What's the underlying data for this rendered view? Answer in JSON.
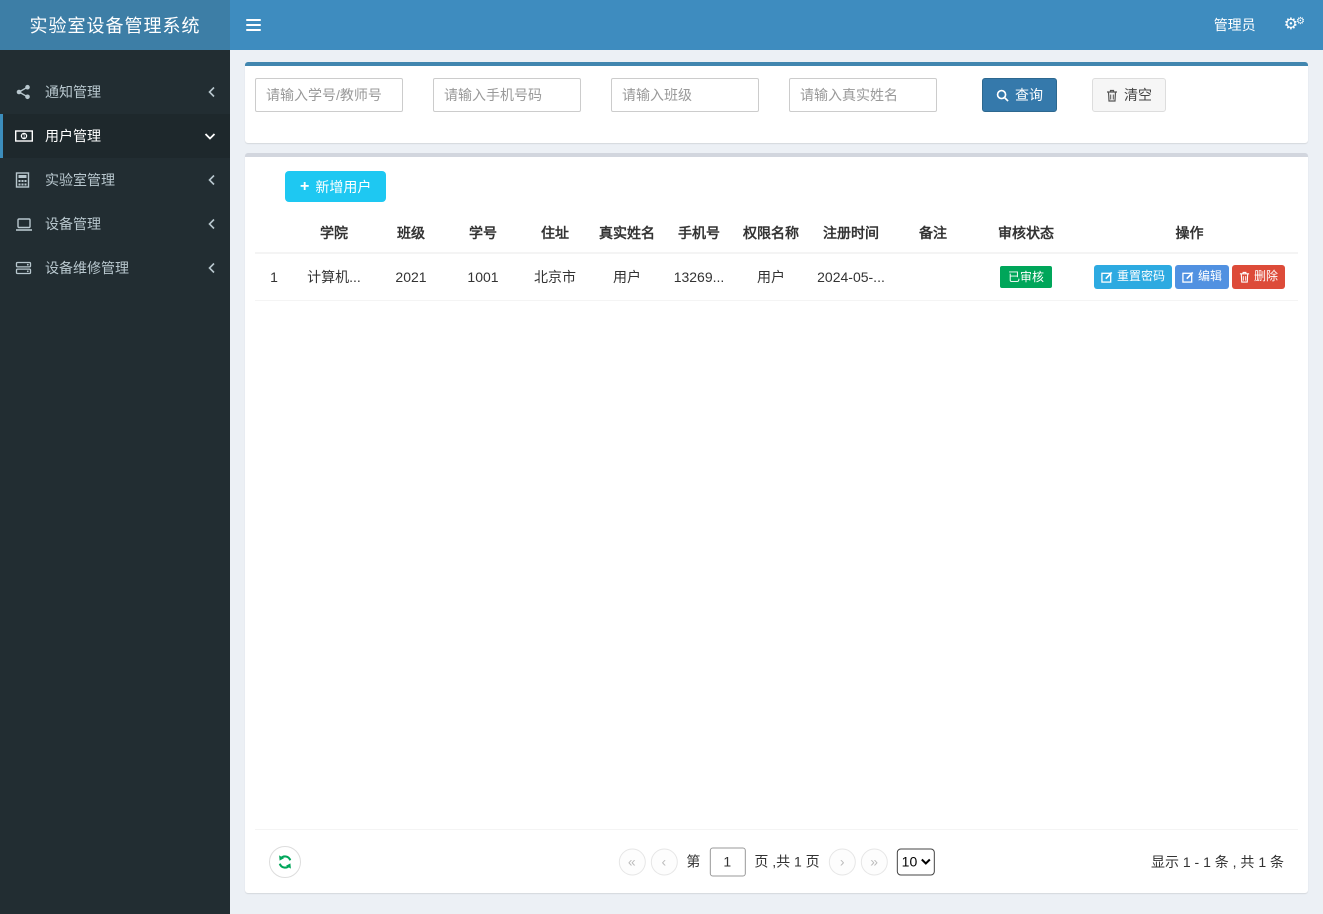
{
  "header": {
    "brand": "实验室设备管理系统",
    "user": "管理员"
  },
  "sidebar": {
    "items": [
      {
        "label": "通知管理"
      },
      {
        "label": "用户管理"
      },
      {
        "label": "实验室管理"
      },
      {
        "label": "设备管理"
      },
      {
        "label": "设备维修管理"
      }
    ]
  },
  "search": {
    "fields": [
      "请输入学号/教师号",
      "请输入手机号码",
      "请输入班级",
      "请输入真实姓名"
    ],
    "query_label": "查询",
    "clear_label": "清空"
  },
  "toolbar": {
    "add_user_label": "新增用户"
  },
  "table": {
    "headers": [
      "",
      "学院",
      "班级",
      "学号",
      "住址",
      "真实姓名",
      "手机号",
      "权限名称",
      "注册时间",
      "备注",
      "审核状态",
      "操作"
    ],
    "rows": [
      {
        "index": "1",
        "college": "计算机...",
        "class_name": "2021",
        "student_no": "1001",
        "address": "北京市",
        "real_name": "用户",
        "phone": "13269...",
        "role": "用户",
        "register_time": "2024-05-...",
        "remark": "",
        "status": "已审核"
      }
    ],
    "actions": {
      "reset_password": "重置密码",
      "edit": "编辑",
      "delete": "删除"
    }
  },
  "pagination": {
    "page_prefix": "第",
    "current_page": "1",
    "page_suffix": "页 ,共 1 页",
    "page_size": "10",
    "summary": "显示 1 - 1 条 , 共 1 条"
  },
  "icons": {
    "gear": "⚙",
    "plus": "+",
    "first_page": "«",
    "prev_page": "‹",
    "next_page": "›",
    "last_page": "»"
  },
  "colors": {
    "navbar": "#3e8cbf",
    "logo": "#3d7ea6",
    "sidebar": "#222d32",
    "sidebar_active": "#1e282c",
    "primary": "#3c8dbc",
    "add_button": "#1ec8f2",
    "success": "#00a65a",
    "reset_button": "#2daae1",
    "edit_button": "#5191e1",
    "delete_button": "#dd4b39"
  }
}
